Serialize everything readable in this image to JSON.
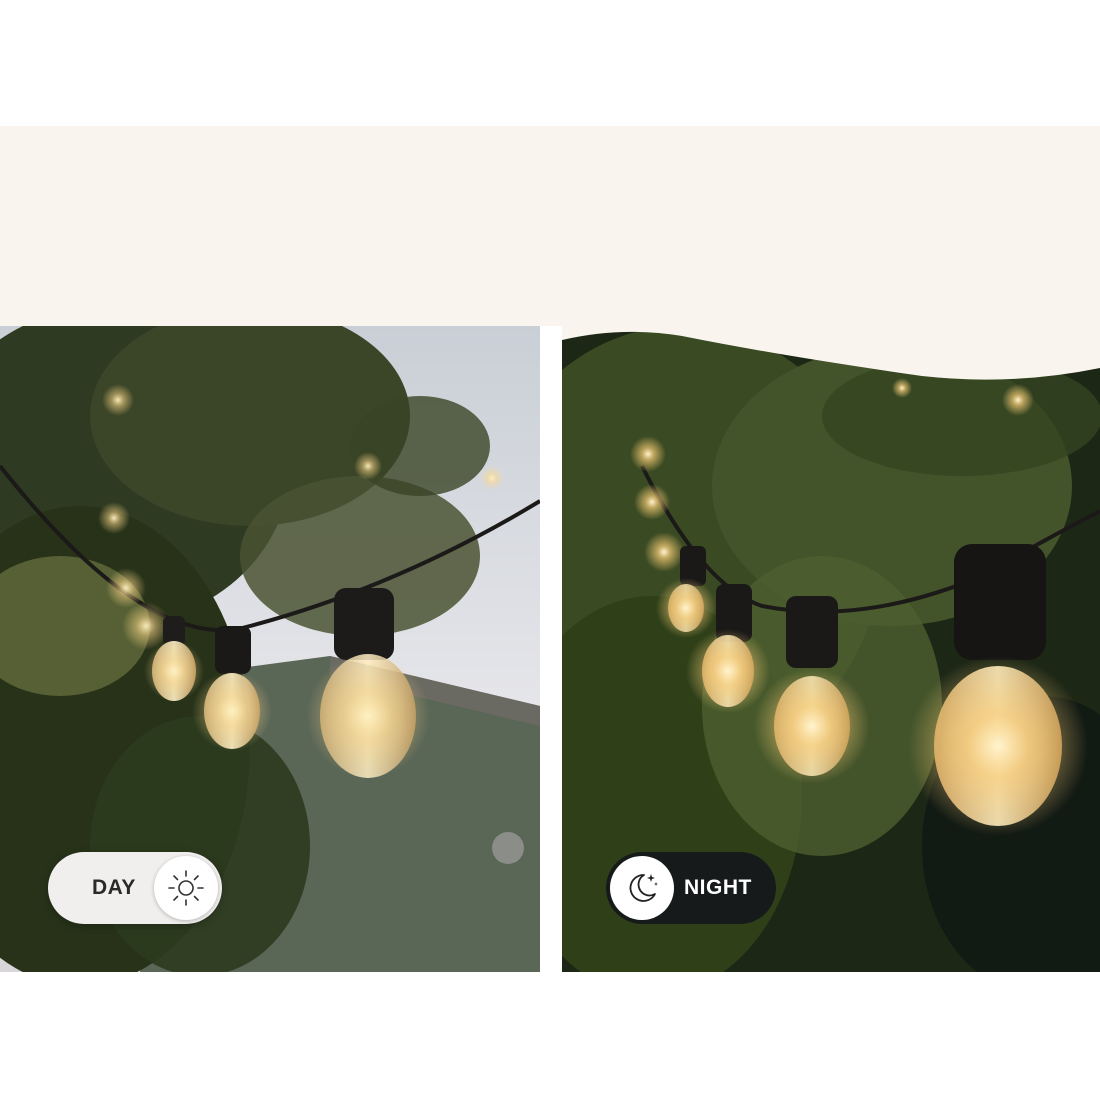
{
  "toggles": {
    "day": {
      "label": "DAY",
      "icon": "sun-icon",
      "state": "on"
    },
    "night": {
      "label": "NIGHT",
      "icon": "moon-stars-icon",
      "state": "on"
    }
  },
  "colors": {
    "banner": "#f9f4ee",
    "bulb_glow": "#ffd98a",
    "day_toggle_bg": "#f0efee",
    "night_toggle_bg": "#161a1a"
  }
}
